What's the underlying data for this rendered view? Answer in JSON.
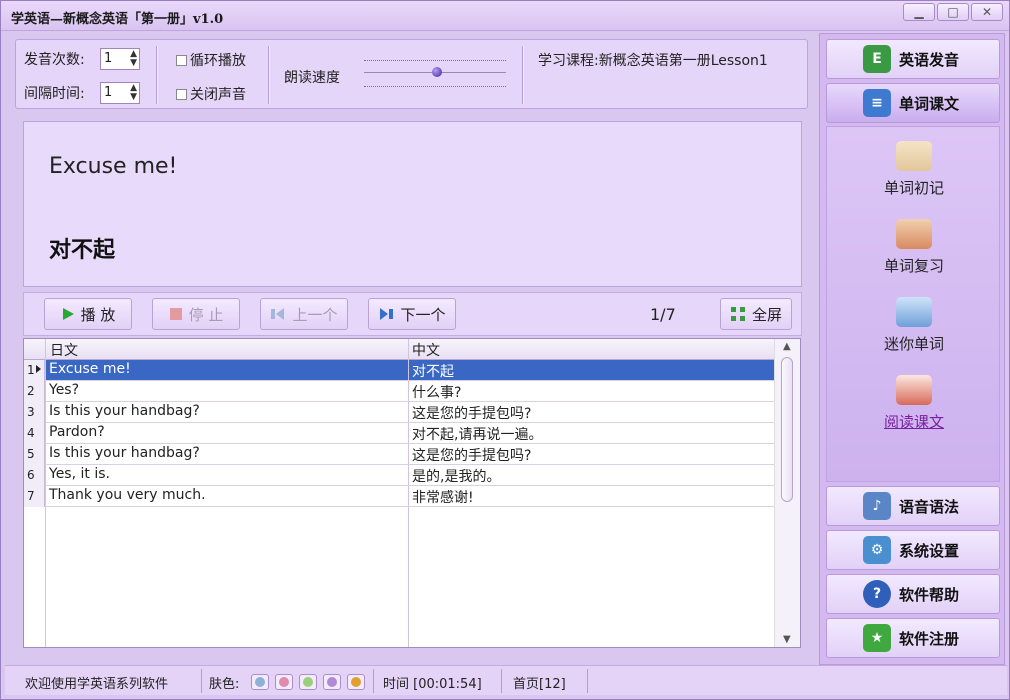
{
  "window": {
    "title": "学英语—新概念英语「第一册」v1.0",
    "min": "▁",
    "max": "□",
    "close": "✕"
  },
  "toolbar": {
    "repeat_label": "发音次数:",
    "repeat_value": "1",
    "interval_label": "间隔时间:",
    "interval_value": "1",
    "loop_label": "循环播放",
    "mute_label": "关闭声音",
    "speed_label": "朗读速度",
    "course_label": "学习课程:新概念英语第一册Lesson1"
  },
  "display": {
    "english": "Excuse me!",
    "chinese": "对不起"
  },
  "controls": {
    "play": "播 放",
    "stop": "停 止",
    "prev": "上一个",
    "next": "下一个",
    "counter": "1/7",
    "fullscreen": "全屏"
  },
  "table": {
    "col1": "日文",
    "col2": "中文",
    "rows": [
      {
        "n": "1",
        "en": "Excuse me!",
        "zh": "对不起"
      },
      {
        "n": "2",
        "en": "Yes?",
        "zh": "什么事?"
      },
      {
        "n": "3",
        "en": "Is this your handbag?",
        "zh": "这是您的手提包吗?"
      },
      {
        "n": "4",
        "en": "Pardon?",
        "zh": "对不起,请再说一遍。"
      },
      {
        "n": "5",
        "en": "Is this your handbag?",
        "zh": "这是您的手提包吗?"
      },
      {
        "n": "6",
        "en": "Yes, it is.",
        "zh": "是的,是我的。"
      },
      {
        "n": "7",
        "en": "Thank you very much.",
        "zh": "非常感谢!"
      }
    ]
  },
  "nav": {
    "pronunciation": "英语发音",
    "words_text": "单词课文",
    "sub": {
      "first_memory": "单词初记",
      "review": "单词复习",
      "mini_words": "迷你单词",
      "read_text": "阅读课文"
    },
    "grammar": "语音语法",
    "settings": "系统设置",
    "help": "软件帮助",
    "register": "软件注册"
  },
  "status": {
    "welcome": "欢迎使用学英语系列软件",
    "skin_label": "肤色:",
    "skin_colors": [
      "#8fb1d8",
      "#e08ab0",
      "#9ad07a",
      "#b08ad6",
      "#e0a030"
    ],
    "time": "时间 [00:01:54]",
    "page": "首页[12]"
  },
  "icons": {
    "play": "play-icon",
    "stop": "stop-icon",
    "prev": "prev-icon",
    "next": "next-icon",
    "fullscreen": "fullscreen-icon"
  }
}
